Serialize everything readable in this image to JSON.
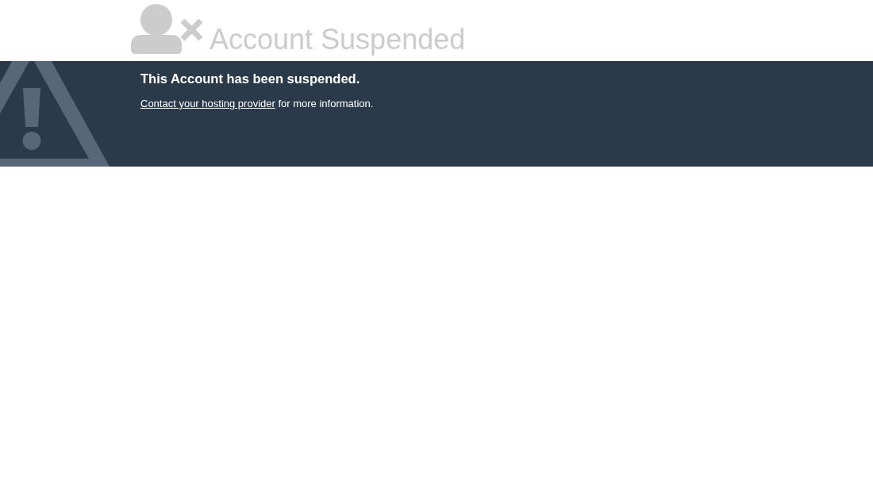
{
  "header": {
    "title": "Account Suspended"
  },
  "notice": {
    "heading": "This Account has been suspended.",
    "message": {
      "link": "Contact your hosting provider",
      "text": "for more information."
    }
  }
}
